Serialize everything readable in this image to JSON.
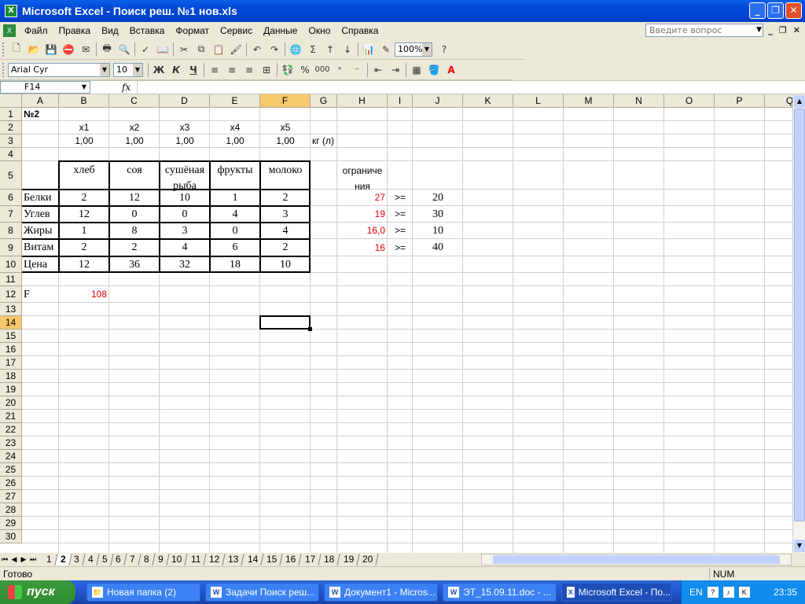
{
  "window": {
    "title": "Microsoft Excel - Поиск реш. №1 нов.xls",
    "app_icon": "excel-icon",
    "controls": [
      "minimize-icon",
      "restore-icon",
      "close-icon"
    ]
  },
  "menubar": {
    "items": [
      "Файл",
      "Правка",
      "Вид",
      "Вставка",
      "Формат",
      "Сервис",
      "Данные",
      "Окно",
      "Справка"
    ],
    "help_placeholder": "Введите вопрос"
  },
  "toolbar": {
    "zoom": "100%",
    "font_name": "Arial Cyr",
    "font_size": "10",
    "bold": "Ж",
    "italic": "К",
    "underline": "Ч",
    "percent": "%",
    "thousands": "000",
    "sum": "Σ"
  },
  "formula_bar": {
    "name_box": "F14",
    "fx": "fx",
    "content": ""
  },
  "columns": [
    "A",
    "B",
    "C",
    "D",
    "E",
    "F",
    "G",
    "H",
    "I",
    "J",
    "K",
    "L",
    "M",
    "N",
    "O",
    "P",
    "Q"
  ],
  "rows": [
    "1",
    "2",
    "3",
    "4",
    "5",
    "6",
    "7",
    "8",
    "9",
    "10",
    "11",
    "12",
    "13",
    "14",
    "15",
    "16",
    "17",
    "18",
    "19",
    "20",
    "21",
    "22",
    "23",
    "24",
    "25",
    "26",
    "27",
    "28",
    "29",
    "30"
  ],
  "selected": {
    "column": "F",
    "row": "14"
  },
  "sheet": {
    "a1": "№2",
    "vars": [
      "x1",
      "x2",
      "x3",
      "x4",
      "x5"
    ],
    "var_values": [
      "1,00",
      "1,00",
      "1,00",
      "1,00",
      "1,00"
    ],
    "unit": "кг (л)",
    "products": [
      "хлеб",
      "соя",
      "сушёная",
      "фрукты",
      "молоко"
    ],
    "products_line2": [
      "",
      "",
      "рыба",
      "",
      ""
    ],
    "constraint_header": [
      "ограниче",
      "ния"
    ],
    "table_rows": [
      {
        "label": "Белки",
        "values": [
          "2",
          "12",
          "10",
          "1",
          "2"
        ],
        "computed": "27",
        "op": ">=",
        "limit": "20"
      },
      {
        "label": "Углев",
        "values": [
          "12",
          "0",
          "0",
          "4",
          "3"
        ],
        "computed": "19",
        "op": ">=",
        "limit": "30"
      },
      {
        "label": "Жиры",
        "values": [
          "1",
          "8",
          "3",
          "0",
          "4"
        ],
        "computed": "16,0",
        "op": ">=",
        "limit": "10"
      },
      {
        "label": "Витам",
        "values": [
          "2",
          "2",
          "4",
          "6",
          "2"
        ],
        "computed": "16",
        "op": ">=",
        "limit": "40"
      },
      {
        "label": "Цена",
        "values": [
          "12",
          "36",
          "32",
          "18",
          "10"
        ]
      }
    ],
    "f_label": "F",
    "f_value": "108"
  },
  "sheet_tabs": [
    "1",
    "2",
    "3",
    "4",
    "5",
    "6",
    "7",
    "8",
    "9",
    "10",
    "11",
    "12",
    "13",
    "14",
    "15",
    "16",
    "17",
    "18",
    "19",
    "20"
  ],
  "active_tab": "2",
  "status": {
    "left": "Готово",
    "num": "NUM"
  },
  "taskbar": {
    "start": "пуск",
    "tasks": [
      "Новая папка (2)",
      "Задачи Поиск реш...",
      "Документ1 - Micros...",
      "ЭТ_15.09.11.doc - ...",
      "Microsoft Excel - По..."
    ],
    "lang": "EN",
    "clock": "23:35"
  },
  "colors": {
    "accent": "#0A5FE6",
    "selected_header": "#F8C86C",
    "computed": "#e00000"
  }
}
